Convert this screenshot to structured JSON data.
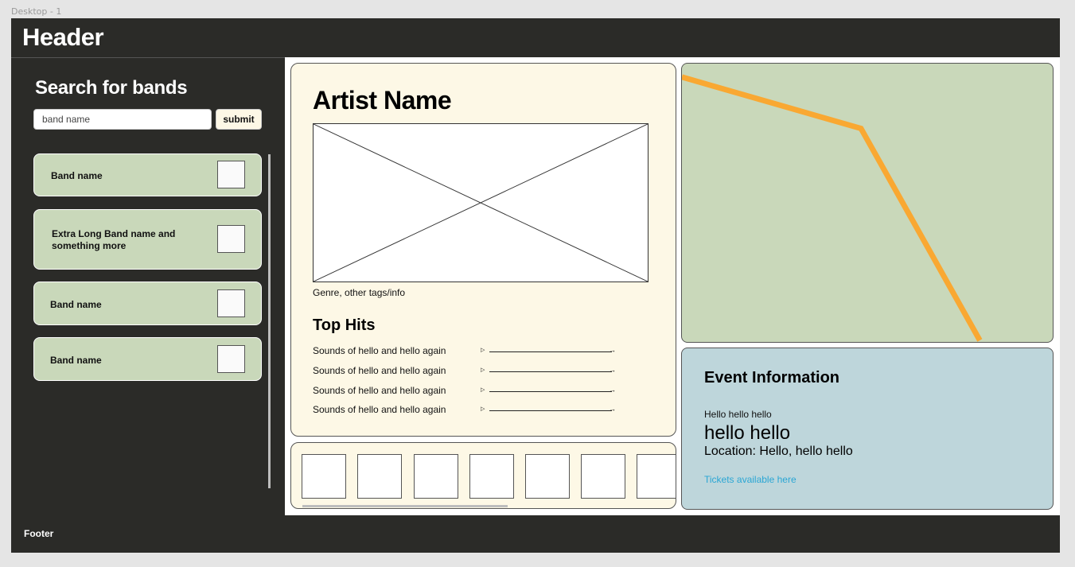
{
  "canvas": {
    "frame_label": "Desktop - 1"
  },
  "header": {
    "title": "Header"
  },
  "sidebar": {
    "title": "Search for bands",
    "search": {
      "placeholder": "band name",
      "value": ""
    },
    "submit_label": "submit",
    "bands": [
      {
        "label": "Band name"
      },
      {
        "label": "Extra Long Band name and something more"
      },
      {
        "label": "Band name"
      },
      {
        "label": "Band name"
      }
    ]
  },
  "artist": {
    "name": "Artist Name",
    "genre": "Genre, other tags/info",
    "top_hits_title": "Top Hits",
    "hits": [
      {
        "title": "Sounds of hello and hello again"
      },
      {
        "title": "Sounds of hello and hello again"
      },
      {
        "title": "Sounds of hello and hello again"
      },
      {
        "title": "Sounds of hello and hello again"
      }
    ],
    "gallery_thumbnail_count": 7
  },
  "event": {
    "title": "Event Information",
    "line1": "Hello hello hello",
    "line2": "hello hello",
    "location": "Location: Hello, hello hello",
    "tickets_link": "Tickets available here"
  },
  "footer": {
    "text": "Footer"
  },
  "colors": {
    "dark": "#2b2b28",
    "cream": "#fdf8e6",
    "sage": "#c9d8ba",
    "event_blue": "#bed6db",
    "route_orange": "#f9a832",
    "link_blue": "#2aa6d4"
  }
}
